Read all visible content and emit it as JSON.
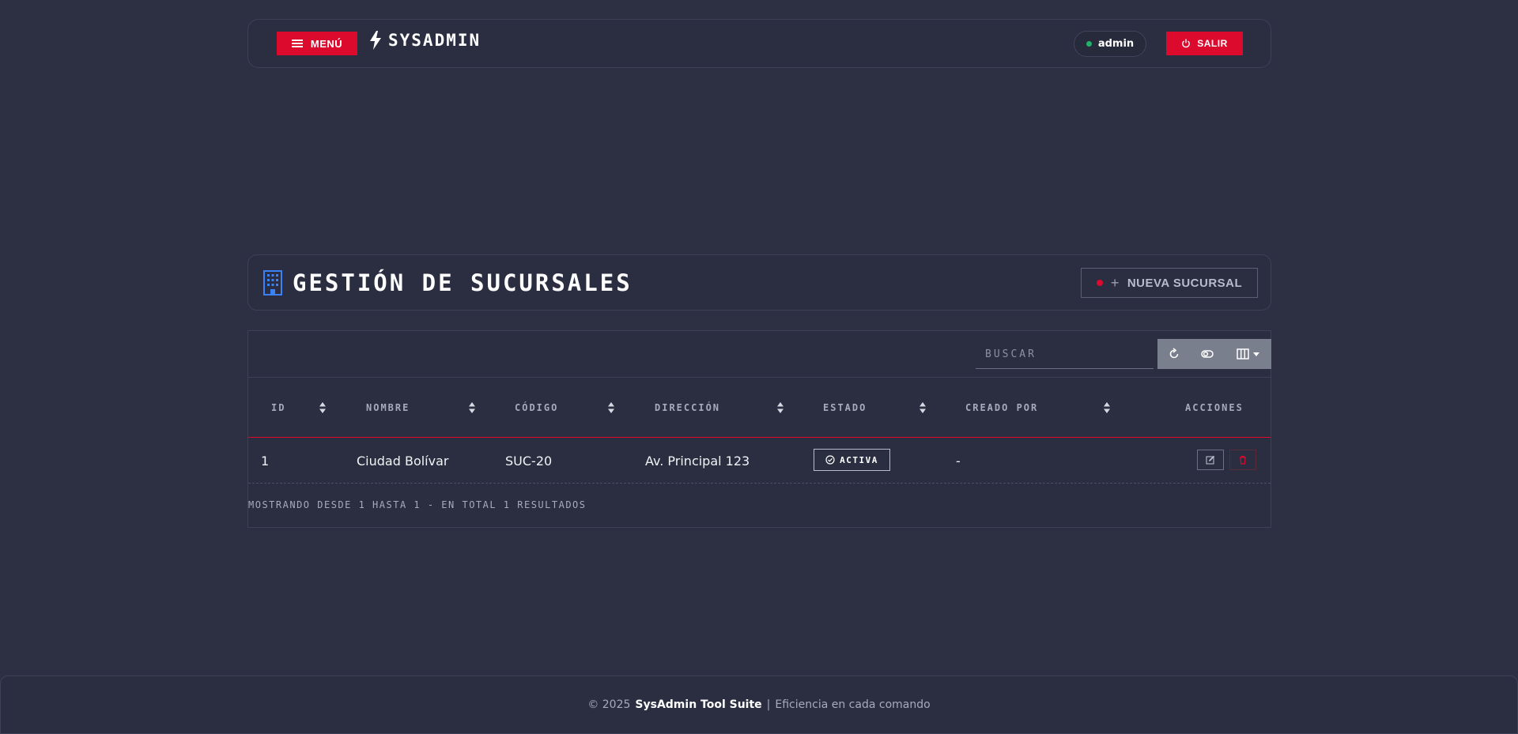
{
  "navbar": {
    "menu_label": "MENÚ",
    "brand": "SYSADMIN",
    "user": "admin",
    "logout_label": "SALIR"
  },
  "header": {
    "title": "GESTIÓN DE SUCURSALES",
    "new_button": "NUEVA SUCURSAL"
  },
  "table": {
    "search_placeholder": "BUSCAR",
    "columns": [
      "ID",
      "NOMBRE",
      "CÓDIGO",
      "DIRECCIÓN",
      "ESTADO",
      "CREADO POR",
      "ACCIONES"
    ],
    "rows": [
      {
        "id": "1",
        "nombre": "Ciudad Bolívar",
        "codigo": "SUC-20",
        "direccion": "Av. Principal 123",
        "estado": "ACTIVA",
        "creado_por": "-"
      }
    ],
    "info": "MOSTRANDO DESDE 1 HASTA 1 - EN TOTAL 1 RESULTADOS"
  },
  "footer": {
    "copyright": "© 2025",
    "product": "SysAdmin Tool Suite",
    "separator": "|",
    "tagline": "Eficiencia en cada comando"
  },
  "colors": {
    "accent": "#dc0a2d",
    "background": "#2c3042",
    "status_online": "#22b36a",
    "icon_blue": "#3b82f6"
  }
}
